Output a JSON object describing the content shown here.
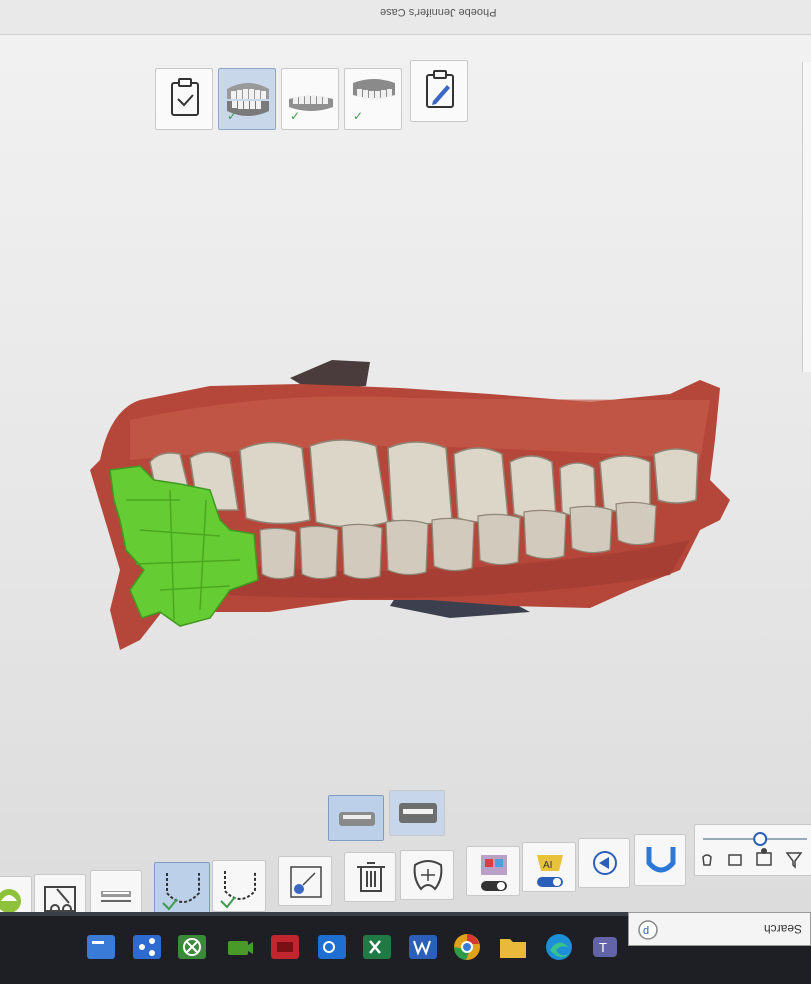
{
  "window": {
    "title": "Phoebe Jennifer's Case"
  },
  "workflow_steps": [
    {
      "name": "prescription",
      "icon": "clipboard-check-icon",
      "checked": false,
      "active": false
    },
    {
      "name": "scan-bite",
      "icon": "dental-arches-icon",
      "checked": true,
      "active": true
    },
    {
      "name": "scan-lower",
      "icon": "lower-arch-icon",
      "checked": true,
      "active": false
    },
    {
      "name": "scan-upper",
      "icon": "upper-arch-icon",
      "checked": true,
      "active": false
    },
    {
      "name": "edit-notes",
      "icon": "clipboard-pencil-icon",
      "checked": false,
      "active": false
    }
  ],
  "view_toggles": [
    {
      "name": "view-jaw-side",
      "icon": "jaw-side-icon",
      "active": true
    },
    {
      "name": "view-jaw-front",
      "icon": "jaw-front-icon",
      "active": false
    }
  ],
  "bottom_tools": [
    {
      "name": "color-tool",
      "icon": "tooth-color-icon"
    },
    {
      "name": "cut-tool",
      "icon": "scissors-model-icon"
    },
    {
      "name": "bite-tool",
      "icon": "bite-icon"
    },
    {
      "name": "lower-arch-select",
      "icon": "lower-arch-select-icon",
      "active": true
    },
    {
      "name": "upper-arch-select",
      "icon": "upper-arch-select-icon"
    },
    {
      "name": "share-tool",
      "icon": "share-model-icon"
    },
    {
      "name": "delete-tool",
      "icon": "trash-icon"
    },
    {
      "name": "margin-tool",
      "icon": "tooth-margin-icon"
    },
    {
      "name": "occlusion-toggle",
      "icon": "occlusion-toggle-icon"
    },
    {
      "name": "ai-scan-toggle",
      "icon": "ai-scan-toggle-icon"
    },
    {
      "name": "play-back",
      "icon": "play-back-icon"
    },
    {
      "name": "arch-view",
      "icon": "arch-view-icon"
    }
  ],
  "scanner_slider": {
    "level": 0.55,
    "icons": [
      "tooth-small-icon",
      "scanner-low-icon",
      "scanner-high-icon",
      "filter-icon"
    ]
  },
  "search": {
    "placeholder": "Search"
  },
  "taskbar_apps": [
    {
      "name": "file-explorer-app",
      "icon": "folder-tab-icon",
      "color": "#3b7bd8"
    },
    {
      "name": "share-app",
      "icon": "share-app-icon",
      "color": "#2e6bd0"
    },
    {
      "name": "xbox-app",
      "icon": "xbox-icon",
      "color": "#3a8a3a"
    },
    {
      "name": "camera-app",
      "icon": "camera-icon",
      "color": "#4a9a2a"
    },
    {
      "name": "red-app",
      "icon": "red-app-icon",
      "color": "#c0262e"
    },
    {
      "name": "outlook-app",
      "icon": "outlook-icon",
      "color": "#1f6fd1"
    },
    {
      "name": "excel-app",
      "icon": "excel-icon",
      "color": "#1f7a45"
    },
    {
      "name": "word-app",
      "icon": "word-icon",
      "color": "#2b5fb8"
    },
    {
      "name": "chrome-app",
      "icon": "chrome-icon",
      "color": "#e0a21c"
    },
    {
      "name": "folder-app",
      "icon": "folder-icon",
      "color": "#e8b93a"
    },
    {
      "name": "edge-app",
      "icon": "edge-icon",
      "color": "#1c8fd6"
    },
    {
      "name": "teams-app",
      "icon": "teams-icon",
      "color": "#6264a7"
    }
  ],
  "colors": {
    "gum": "#b5473a",
    "teeth": "#dcd6c8",
    "selection": "#66cc33",
    "active_tool": "#bcd0ea"
  }
}
